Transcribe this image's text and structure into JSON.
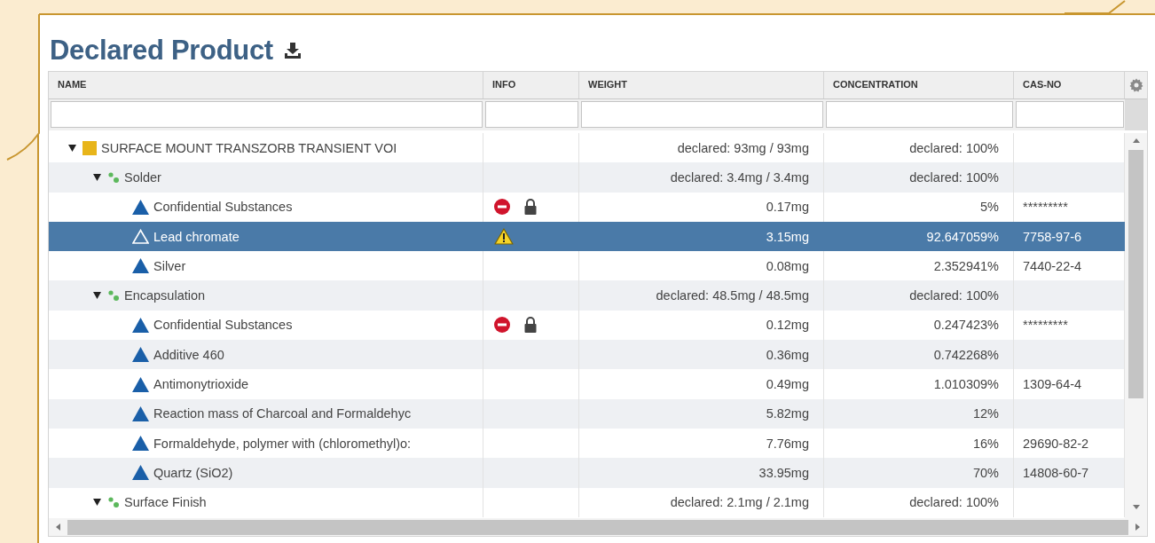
{
  "title": "Declared Product",
  "columns": [
    {
      "label": "NAME"
    },
    {
      "label": "INFO"
    },
    {
      "label": "WEIGHT"
    },
    {
      "label": "CONCENTRATION"
    },
    {
      "label": "CAS-NO"
    }
  ],
  "tree": [
    {
      "kind": "product",
      "name": "SURFACE MOUNT TRANSZORB TRANSIENT VOI",
      "expanded": true,
      "selected": false,
      "weight": "declared: 93mg / 93mg",
      "concentration": "declared: 100%",
      "children": [
        {
          "kind": "material",
          "name": "Solder",
          "expanded": true,
          "selected": false,
          "weight": "declared: 3.4mg / 3.4mg",
          "concentration": "declared: 100%",
          "children": [
            {
              "kind": "substance",
              "name": "Confidential Substances",
              "selected": false,
              "restricted": true,
              "locked": true,
              "warning": false,
              "weight": "0.17mg",
              "concentration": "5%",
              "cas_no": "*********"
            },
            {
              "kind": "substance",
              "name": "Lead chromate",
              "selected": true,
              "restricted": false,
              "locked": false,
              "warning": true,
              "weight": "3.15mg",
              "concentration": "92.647059%",
              "cas_no": "7758-97-6"
            },
            {
              "kind": "substance",
              "name": "Silver",
              "selected": false,
              "restricted": false,
              "locked": false,
              "warning": false,
              "weight": "0.08mg",
              "concentration": "2.352941%",
              "cas_no": "7440-22-4"
            }
          ]
        },
        {
          "kind": "material",
          "name": "Encapsulation",
          "expanded": true,
          "selected": false,
          "weight": "declared: 48.5mg / 48.5mg",
          "concentration": "declared: 100%",
          "children": [
            {
              "kind": "substance",
              "name": "Confidential Substances",
              "selected": false,
              "restricted": true,
              "locked": true,
              "warning": false,
              "weight": "0.12mg",
              "concentration": "0.247423%",
              "cas_no": "*********"
            },
            {
              "kind": "substance",
              "name": "Additive 460",
              "selected": false,
              "restricted": false,
              "locked": false,
              "warning": false,
              "weight": "0.36mg",
              "concentration": "0.742268%"
            },
            {
              "kind": "substance",
              "name": "Antimonytrioxide",
              "selected": false,
              "restricted": false,
              "locked": false,
              "warning": false,
              "weight": "0.49mg",
              "concentration": "1.010309%",
              "cas_no": "1309-64-4"
            },
            {
              "kind": "substance",
              "name": "Reaction mass of Charcoal and Formaldehyc",
              "selected": false,
              "restricted": false,
              "locked": false,
              "warning": false,
              "weight": "5.82mg",
              "concentration": "12%"
            },
            {
              "kind": "substance",
              "name": "Formaldehyde, polymer with (chloromethyl)o:",
              "selected": false,
              "restricted": false,
              "locked": false,
              "warning": false,
              "weight": "7.76mg",
              "concentration": "16%",
              "cas_no": "29690-82-2"
            },
            {
              "kind": "substance",
              "name": "Quartz (SiO2)",
              "selected": false,
              "restricted": false,
              "locked": false,
              "warning": false,
              "weight": "33.95mg",
              "concentration": "70%",
              "cas_no": "14808-60-7"
            }
          ]
        },
        {
          "kind": "material",
          "name": "Surface Finish",
          "expanded": true,
          "selected": false,
          "weight": "declared: 2.1mg / 2.1mg",
          "concentration": "declared: 100%"
        }
      ]
    }
  ]
}
